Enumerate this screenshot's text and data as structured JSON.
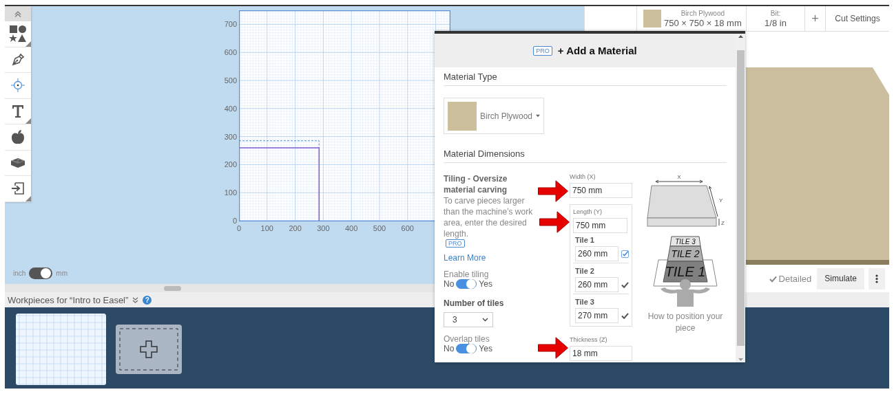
{
  "toolbar": {
    "tools": [
      {
        "kind": "shapes",
        "selected": false
      },
      {
        "kind": "pen",
        "selected": false
      },
      {
        "kind": "target",
        "selected": true
      },
      {
        "kind": "text",
        "selected": false
      },
      {
        "kind": "apple",
        "selected": false
      },
      {
        "kind": "brick",
        "selected": false
      },
      {
        "kind": "import",
        "selected": false
      }
    ]
  },
  "canvas": {
    "y_ticks": [
      "700",
      "600",
      "500",
      "400",
      "300",
      "200",
      "100",
      "0"
    ],
    "x_ticks": [
      "0",
      "100",
      "200",
      "300",
      "400",
      "500",
      "600"
    ],
    "unit_toggle": {
      "left": "inch",
      "right": "mm",
      "on": true
    }
  },
  "header": {
    "material": {
      "name": "Birch Plywood",
      "size": "750 × 750 × 18 mm"
    },
    "bit": {
      "label": "Bit:",
      "value": "1/8 in"
    },
    "add": "+",
    "cut_settings": "Cut Settings"
  },
  "preview_footer": {
    "detailed": {
      "label": "Detailed",
      "checked": true
    },
    "simulate": "Simulate"
  },
  "workpieces": {
    "title": "Workpieces for “Intro to Easel”",
    "help": "?"
  },
  "modal": {
    "badge": "PRO",
    "title": "+ Add a Material",
    "material_type": {
      "heading": "Material Type",
      "value": "Birch Plywood"
    },
    "dimensions": {
      "heading": "Material Dimensions",
      "tiling_title": "Tiling - Oversize material carving",
      "tiling_text": "To carve pieces larger than the machine’s work area, enter the desired length.",
      "pro_badge": "PRO",
      "learn_more": "Learn More",
      "enable_tiling": {
        "label": "Enable tiling",
        "off_label": "No",
        "on_label": "Yes",
        "on": true
      },
      "number_of_tiles": {
        "label": "Number of tiles",
        "value": "3"
      },
      "overlap_tiles": {
        "label": "Overlap tiles",
        "off_label": "No",
        "on_label": "Yes",
        "on": true
      },
      "width": {
        "label": "Width (X)",
        "value": "750 mm"
      },
      "length": {
        "label": "Length (Y)",
        "value": "750 mm"
      },
      "tiles": [
        {
          "label": "Tile 1",
          "value": "260 mm",
          "kind": "checkbox",
          "checked": true
        },
        {
          "label": "Tile 2",
          "value": "260 mm",
          "kind": "tick",
          "checked": true
        },
        {
          "label": "Tile 3",
          "value": "270 mm",
          "kind": "tick",
          "checked": true
        }
      ],
      "thickness": {
        "label": "Thickness (Z)",
        "value": "18 mm"
      },
      "diagram": {
        "axes": [
          "X",
          "Y",
          "Z"
        ],
        "tile_labels": [
          "TILE 3",
          "TILE 2",
          "TILE 1"
        ],
        "caption": "How to position your piece"
      }
    }
  }
}
